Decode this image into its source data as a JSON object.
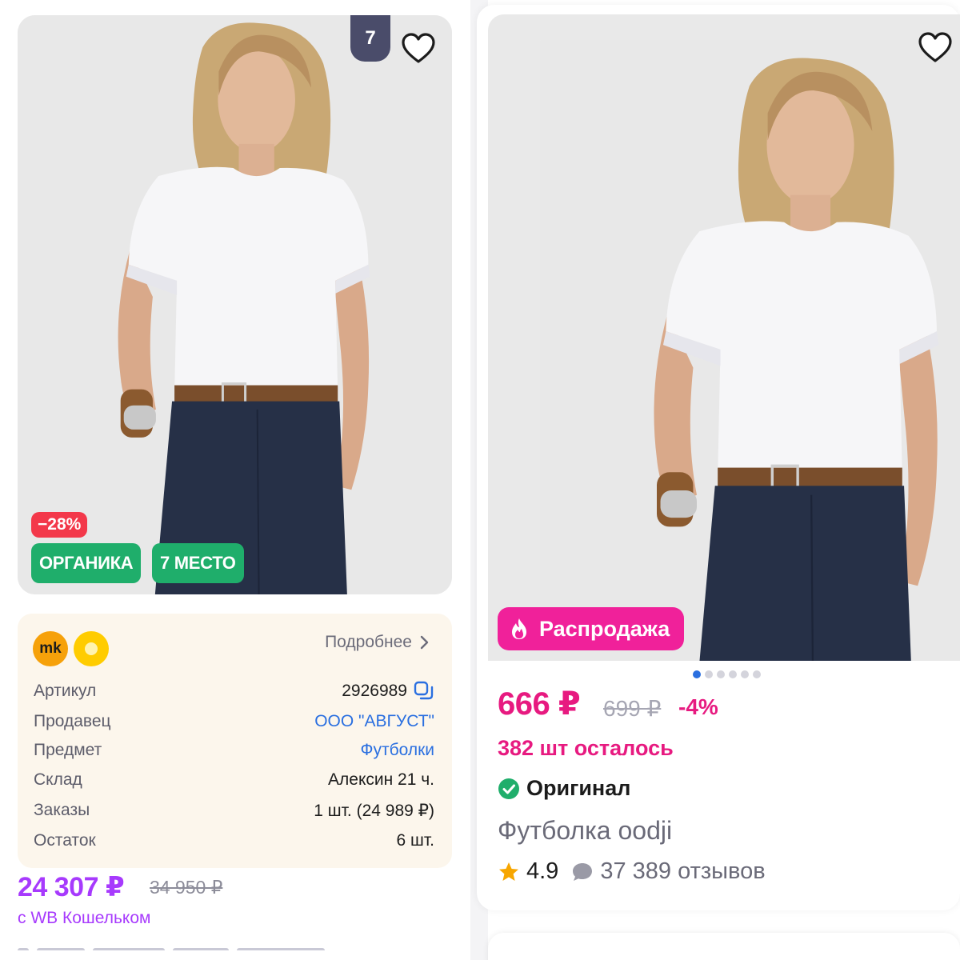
{
  "left_card": {
    "rank_badge": "7",
    "discount_badge": "−28%",
    "badges": [
      "ОРГАНИКА",
      "7 МЕСТО"
    ],
    "seller_logo_text": "mk",
    "more_link": "Подробнее",
    "info": [
      {
        "key": "Артикул",
        "value": "2926989"
      },
      {
        "key": "Продавец",
        "value": "ООО \"АВГУСТ\""
      },
      {
        "key": "Предмет",
        "value": "Футболки"
      },
      {
        "key": "Склад",
        "value": "Алексин 21 ч."
      },
      {
        "key": "Заказы",
        "value": "1 шт. (24 989 ₽)"
      },
      {
        "key": "Остаток",
        "value": "6 шт."
      }
    ],
    "price": "24 307 ₽",
    "old_price": "34 950 ₽",
    "wallet_note": "с WB Кошельком"
  },
  "right_card": {
    "sale_badge": "Распродажа",
    "price": "666 ₽",
    "old_price": "699 ₽",
    "discount": "-4%",
    "stock_left": "382 шт осталось",
    "original_label": "Оригинал",
    "product_name": "Футболка oodji",
    "rating": "4.9",
    "reviews": "37 389 отзывов",
    "carousel_dots": 6,
    "carousel_active": 0
  },
  "icons": {
    "favorite": "heart-outline-icon",
    "copy": "copy-icon",
    "chevron": "chevron-right-icon",
    "fire": "fire-icon",
    "verified": "check-circle-icon",
    "star": "star-icon",
    "comment": "comment-bubble-icon"
  },
  "colors": {
    "accent_purple": "#a73afd",
    "accent_pink": "#e71a80",
    "sale_pink": "#f0219a",
    "green_badge": "#1fae6b",
    "discount_red": "#f3384a",
    "link_blue": "#2a6fe0"
  }
}
